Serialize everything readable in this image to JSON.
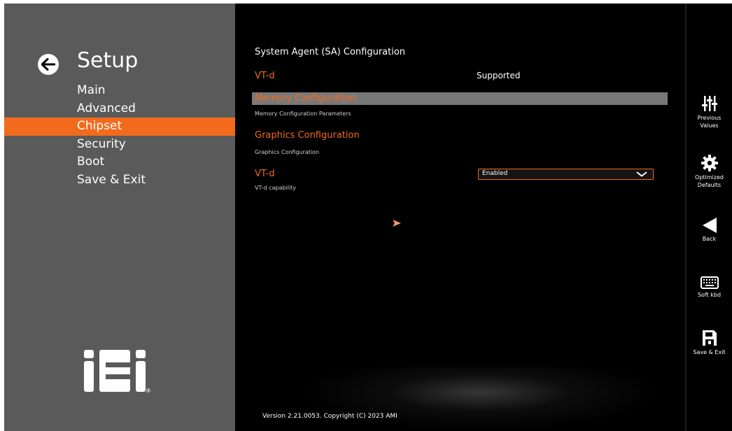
{
  "sidebar": {
    "title": "Setup",
    "items": [
      {
        "label": "Main",
        "active": false
      },
      {
        "label": "Advanced",
        "active": false
      },
      {
        "label": "Chipset",
        "active": true
      },
      {
        "label": "Security",
        "active": false
      },
      {
        "label": "Boot",
        "active": false
      },
      {
        "label": "Save & Exit",
        "active": false
      }
    ],
    "logo_icon": "iei-logo",
    "logo_mark": "®"
  },
  "main": {
    "section_title": "System Agent (SA) Configuration",
    "rows": {
      "vtd_supported": {
        "label": "VT-d",
        "value": "Supported"
      },
      "memory_config": {
        "label": "Memory Configuration",
        "help": "Memory Configuration Parameters"
      },
      "graphics_config": {
        "label": "Graphics Configuration",
        "help": "Graphics Configuration"
      },
      "vtd_setting": {
        "label": "VT-d",
        "value": "Enabled",
        "help": "VT-d capability"
      }
    },
    "version": "Version 2.21.0053. Copyright (C) 2023 AMI"
  },
  "toolbar": {
    "items": [
      {
        "icon": "sliders-icon",
        "label_line1": "Previous",
        "label_line2": "Values"
      },
      {
        "icon": "gear-icon",
        "label_line1": "Optimized",
        "label_line2": "Defaults"
      },
      {
        "icon": "back-triangle-icon",
        "label_line1": "Back",
        "label_line2": ""
      },
      {
        "icon": "keyboard-icon",
        "label_line1": "Soft kbd",
        "label_line2": ""
      },
      {
        "icon": "save-icon",
        "label_line1": "Save & Exit",
        "label_line2": ""
      }
    ]
  },
  "colors": {
    "accent": "#f26b1d",
    "sidebar_bg": "#5a5a5a",
    "highlight_bg": "#787878",
    "main_bg": "#000000"
  }
}
